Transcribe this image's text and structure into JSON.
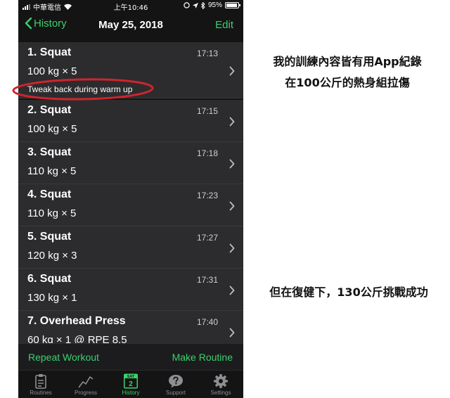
{
  "status_bar": {
    "carrier": "中華電信",
    "time": "上午10:46",
    "battery": "95%"
  },
  "nav": {
    "back_label": "History",
    "title": "May 25, 2018",
    "edit_label": "Edit"
  },
  "exercises": [
    {
      "name": "1. Squat",
      "time": "17:13",
      "detail": "100 kg × 5",
      "note": "Tweak back during warm up"
    },
    {
      "name": "2. Squat",
      "time": "17:15",
      "detail": "100 kg × 5"
    },
    {
      "name": "3. Squat",
      "time": "17:18",
      "detail": "110 kg × 5"
    },
    {
      "name": "4. Squat",
      "time": "17:23",
      "detail": "110 kg × 5"
    },
    {
      "name": "5. Squat",
      "time": "17:27",
      "detail": "120 kg × 3"
    },
    {
      "name": "6. Squat",
      "time": "17:31",
      "detail": "130 kg × 1"
    },
    {
      "name": "7. Overhead Press",
      "time": "17:40",
      "detail": "60 kg × 1 @ RPE 8.5"
    }
  ],
  "actions": {
    "repeat_label": "Repeat Workout",
    "routine_label": "Make Routine"
  },
  "tabs": [
    {
      "label": "Routines",
      "icon": "clipboard-icon"
    },
    {
      "label": "Progress",
      "icon": "line-graph-icon"
    },
    {
      "label": "History",
      "icon": "calendar-icon",
      "calendar_day": "SAT",
      "calendar_date": "2",
      "active": true
    },
    {
      "label": "Support",
      "icon": "question-bubble-icon"
    },
    {
      "label": "Settings",
      "icon": "gear-icon"
    }
  ],
  "annotations": {
    "line1": "我的訓練內容皆有用App紀錄",
    "line2": "在100公斤的熱身組拉傷",
    "line3": "但在復健下，130公斤挑戰成功"
  },
  "colors": {
    "accent": "#3bd16f",
    "background": "#141414",
    "row_background": "#2c2c2e",
    "annotation_circle": "#d0242c"
  }
}
